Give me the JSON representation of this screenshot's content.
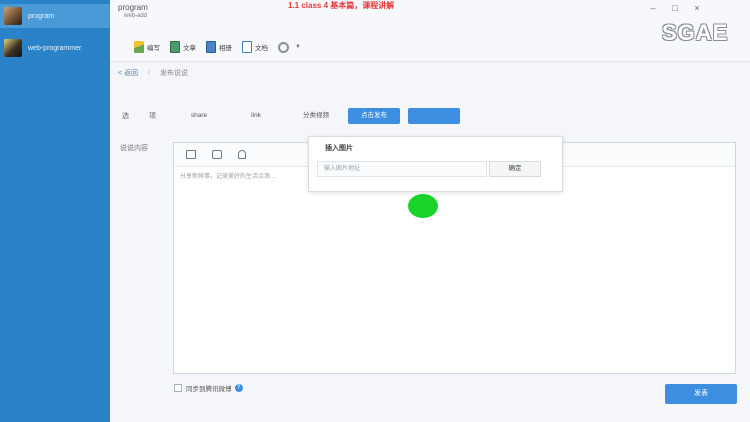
{
  "sidebar": {
    "items": [
      {
        "label": "program"
      },
      {
        "label": "web-programmer"
      }
    ]
  },
  "header": {
    "title": "program",
    "subtitle": "web-add",
    "banner": "1.1 class 4 基本篇，课程讲解"
  },
  "toolbar": {
    "items": [
      {
        "label": "编写",
        "icon": "pencil-icon"
      },
      {
        "label": "文章",
        "icon": "image-icon"
      },
      {
        "label": "相册",
        "icon": "photo-icon"
      },
      {
        "label": "文档",
        "icon": "doc-icon"
      },
      {
        "label": "",
        "icon": "gear-icon"
      }
    ]
  },
  "breadcrumb": {
    "back": "< 返回",
    "separator": "/",
    "current": "发布说说"
  },
  "options": {
    "label_a": "选",
    "label_b": "项",
    "items": [
      "share",
      "link",
      "分类视频",
      "点击发布"
    ]
  },
  "editor": {
    "side_label": "说说内容",
    "hint": "分享新鲜事，记录美好的生活点滴..."
  },
  "popup": {
    "title": "插入图片",
    "input_placeholder": "输入图片地址",
    "button": "确定"
  },
  "footer": {
    "checkbox_label": "同步到腾讯微博",
    "help": "?",
    "send": "发表"
  },
  "watermark": "SGAE",
  "colors": {
    "sidebar": "#2a82c9",
    "accent": "#3d8ee0",
    "banner": "#e23a3a",
    "cursor": "#19d32a"
  }
}
